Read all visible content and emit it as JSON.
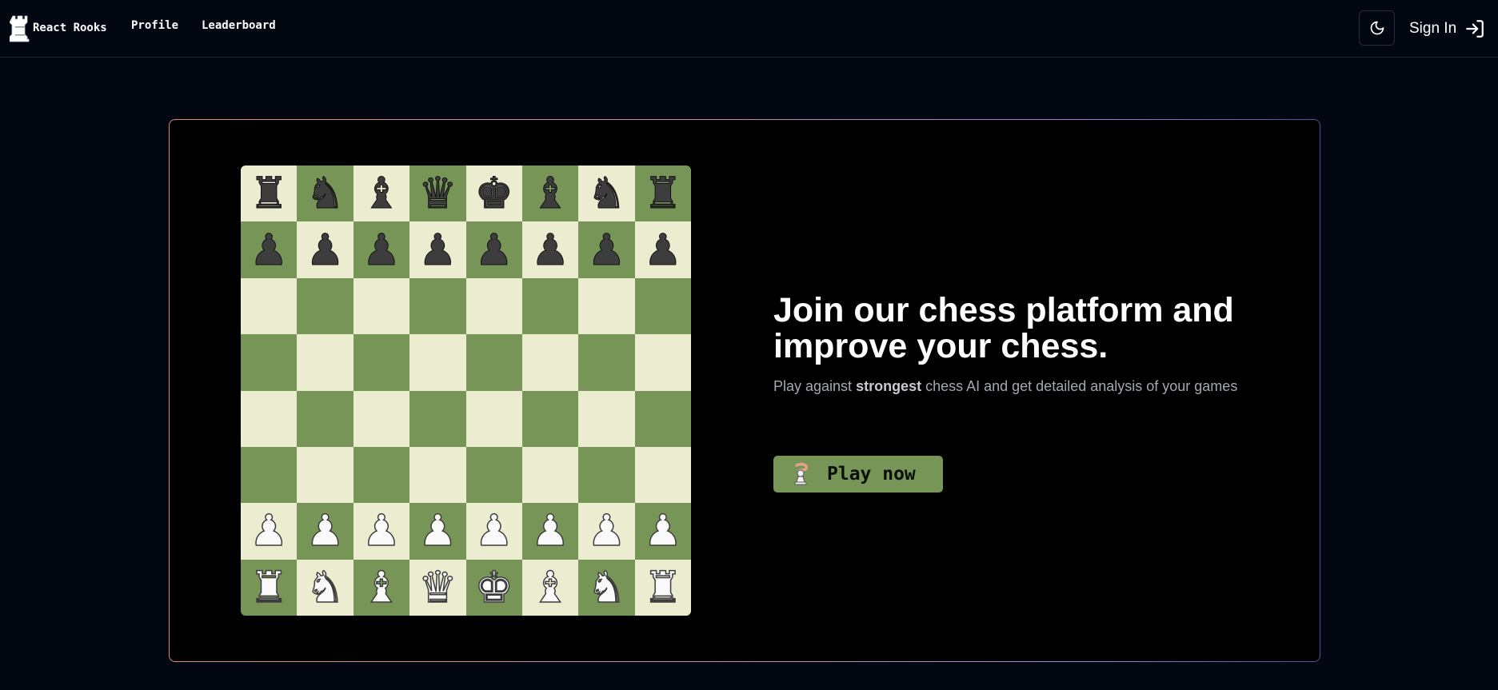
{
  "nav": {
    "brand": "React Rooks",
    "links": [
      {
        "label": "Profile"
      },
      {
        "label": "Leaderboard"
      }
    ],
    "theme_toggle_icon": "moon-icon",
    "sign_in_label": "Sign In",
    "sign_in_icon": "sign-in-icon"
  },
  "hero": {
    "title": "Join our chess platform and improve your chess.",
    "subtitle_before": "Play against ",
    "subtitle_emphasis": "strongest",
    "subtitle_after": " chess AI and get detailed analysis of your games",
    "cta_label": "Play now",
    "cta_icon": "chess-pawn-icon"
  },
  "board": {
    "light_color": "#ebecd0",
    "dark_color": "#779556",
    "rows": [
      [
        "r",
        "n",
        "b",
        "q",
        "k",
        "b",
        "n",
        "r"
      ],
      [
        "p",
        "p",
        "p",
        "p",
        "p",
        "p",
        "p",
        "p"
      ],
      [
        "",
        "",
        "",
        "",
        "",
        "",
        "",
        ""
      ],
      [
        "",
        "",
        "",
        "",
        "",
        "",
        "",
        ""
      ],
      [
        "",
        "",
        "",
        "",
        "",
        "",
        "",
        ""
      ],
      [
        "",
        "",
        "",
        "",
        "",
        "",
        "",
        ""
      ],
      [
        "P",
        "P",
        "P",
        "P",
        "P",
        "P",
        "P",
        "P"
      ],
      [
        "R",
        "N",
        "B",
        "Q",
        "K",
        "B",
        "N",
        "R"
      ]
    ]
  },
  "colors": {
    "background": "#030712",
    "hero_background": "#000000",
    "accent_green": "#779556"
  }
}
